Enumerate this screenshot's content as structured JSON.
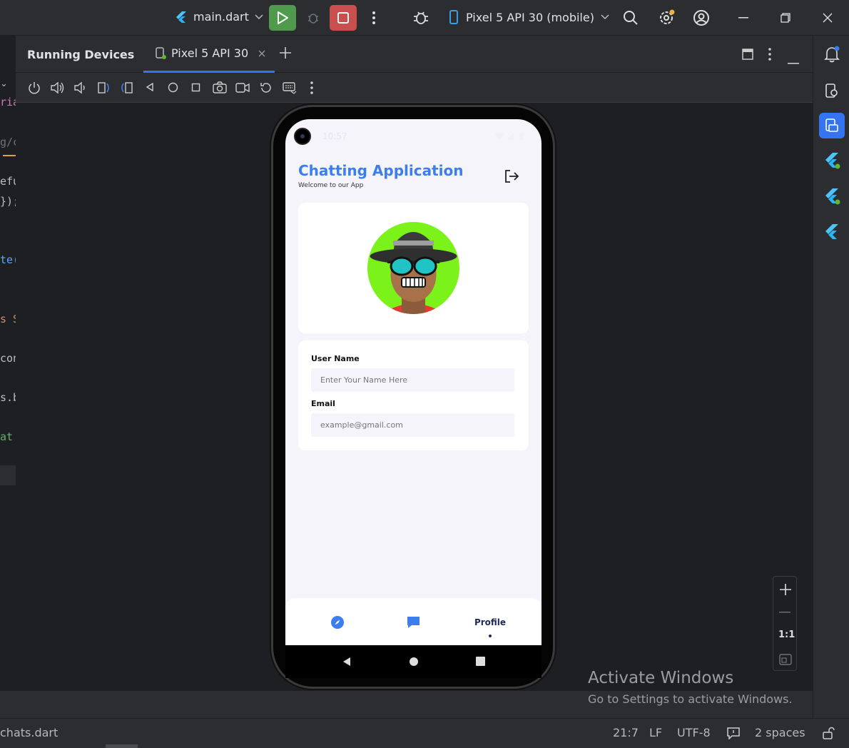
{
  "titlebar": {
    "file_selector": "main.dart",
    "device_selector": "Pixel 5 API 30 (mobile)"
  },
  "panel": {
    "title": "Running Devices",
    "tab_label": "Pixel 5 API 30"
  },
  "editor_peek": [
    "ria",
    "g/c",
    "efu",
    "});",
    "te(",
    "s S",
    "con",
    "s.b",
    "at"
  ],
  "phone": {
    "status_time": "10:57",
    "app_title": "Chatting Application",
    "app_subtitle": "Welcome to our App",
    "form": {
      "username_label": "User Name",
      "username_placeholder": "Enter Your Name Here",
      "email_label": "Email",
      "email_placeholder": "example@gmail.com"
    },
    "bottom_nav": {
      "profile_label": "Profile"
    }
  },
  "zoom": {
    "one_to_one": "1:1"
  },
  "watermark": {
    "line1": "Activate Windows",
    "line2": "Go to Settings to activate Windows."
  },
  "statusbar": {
    "file": "chats.dart",
    "position": "21:7",
    "line_ending": "LF",
    "encoding": "UTF-8",
    "indent": "2 spaces"
  },
  "colors": {
    "accent": "#3d7eee",
    "run": "#4f9a4c",
    "stop": "#c94f4f",
    "avatar_bg": "#7cf21b"
  }
}
